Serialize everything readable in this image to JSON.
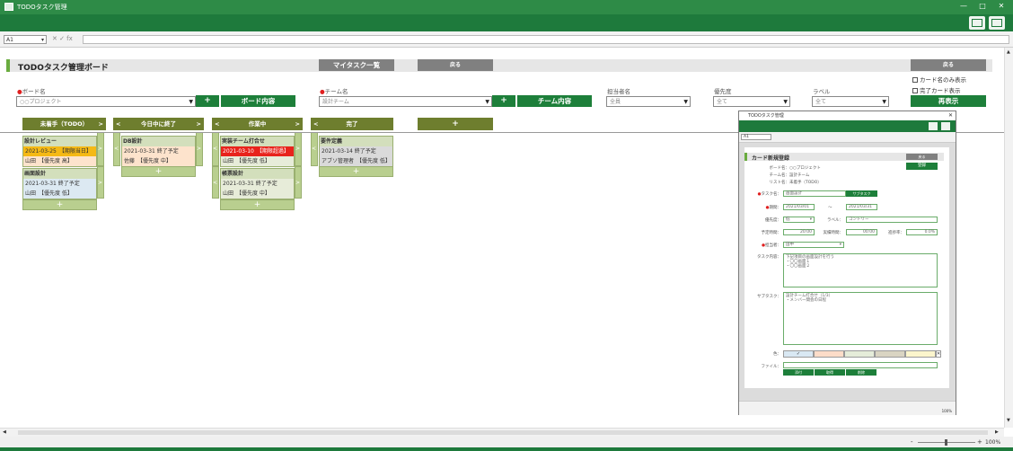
{
  "window": {
    "title": "TODOタスク管理",
    "min": "—",
    "max": "□",
    "close": "✕"
  },
  "formula": {
    "namebox": "A1",
    "icons": "✕ ✓ fx"
  },
  "board": {
    "title": "TODOタスク管理ボード",
    "my_tasks_btn": "マイタスク一覧",
    "back_btn": "戻る",
    "back_btn_right": "戻る",
    "board_name_label": "ボード名",
    "board_select": "○○プロジェクト",
    "board_plus": "+",
    "board_detail_btn": "ボード内容",
    "team_label": "チーム名",
    "team_select": "設計チーム",
    "team_plus": "+",
    "team_detail_btn": "チーム内容",
    "owner_label": "担当者名",
    "owner_select": "全員",
    "priority_label": "優先度",
    "priority_select": "全て",
    "label_label": "ラベル",
    "label_select": "全て",
    "chk_card_only": "カード名のみ表示",
    "chk_done": "完了カード表示",
    "redisplay_btn": "再表示"
  },
  "columns": [
    {
      "title": "未着手（TODO）",
      "left": "",
      "right": ">"
    },
    {
      "title": "今日中に終了",
      "left": "<",
      "right": ">"
    },
    {
      "title": "作業中",
      "left": "<",
      "right": ">"
    },
    {
      "title": "完了",
      "left": "<",
      "right": ""
    }
  ],
  "add_column": "+",
  "cards": {
    "c1": {
      "title": "設計レビュー",
      "date": "2021-03-25　【期限当日】",
      "assignee": "山田　【優先度 高】"
    },
    "c2": {
      "title": "画面設計",
      "date": "2021-03-31 終了予定",
      "assignee": "山田　【優先度 低】"
    },
    "c3": {
      "title": "DB設計",
      "date": "2021-03-31 終了予定",
      "assignee": "佐藤　【優先度 中】"
    },
    "c4": {
      "title": "実装チーム打合せ",
      "date": "2021-03-10　【期限超過】",
      "assignee": "山田　【優先度 低】"
    },
    "c5": {
      "title": "帳票設計",
      "date": "2021-03-31 終了予定",
      "assignee": "山田　【優先度 中】"
    },
    "c6": {
      "title": "要件定義",
      "date": "2021-03-14 終了予定",
      "assignee": "アブソ管理者　【優先度 低】"
    }
  },
  "add_card": "+",
  "dialog": {
    "title": "TODOタスク管理",
    "namebox": "A1",
    "heading": "カード新規登録",
    "back": "戻る",
    "save": "登録",
    "board_label": "ボード名：",
    "board_value": "○○プロジェクト",
    "team_label": "チーム名：",
    "team_value": "設計チーム",
    "list_label": "リスト名：",
    "list_value": "未着手（TODO）",
    "task_label": "タスク名：",
    "task_value": "画面設計",
    "subtask_btn": "サブタスク",
    "period_label": "期間：",
    "date_from": "2021/03/01",
    "date_sep": "～",
    "date_to": "2021/03/31",
    "priority_label": "優先度：",
    "priority_value": "低",
    "label_label": "ラベル：",
    "label_value": "コントリー",
    "plan_label": "予定時間：",
    "plan_value": "20:00",
    "actual_label": "実績時間：",
    "actual_value": "00:00",
    "progress_label": "進捗率：",
    "progress_value": "0.0%",
    "owner_label": "担当者：",
    "owner_value": "田中",
    "content_label": "タスク内容：",
    "content_value": "下記項目の画面設計を行う\n・〇〇画面１\n・〇〇画面２",
    "subtask_label": "サブタスク：",
    "subtask_value": "設計チーム打合せ（1/3）\n・メンバー間会の日程",
    "color_label": "色：",
    "color_check": "✓",
    "file_label": "ファイル：",
    "file_btn1": "添付",
    "file_btn2": "取得",
    "file_btn3": "削除",
    "zoom": "100%"
  },
  "status": {
    "zoom": "100%",
    "minus": "-",
    "plus": "+"
  }
}
